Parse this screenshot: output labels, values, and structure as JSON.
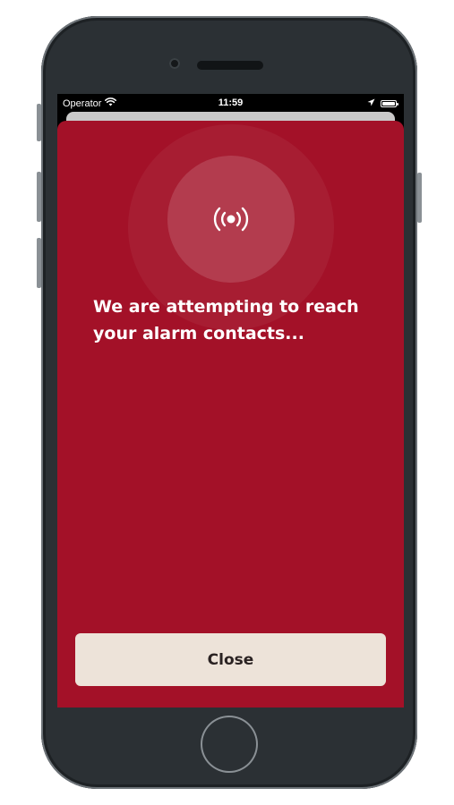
{
  "status_bar": {
    "carrier": "Operator",
    "time": "11:59",
    "wifi_icon": "wifi-icon",
    "location_icon": "location-arrow-icon",
    "battery_icon": "battery-icon"
  },
  "alarm": {
    "icon": "broadcast-signal-icon",
    "message": "We are attempting to reach your alarm contacts...",
    "close_label": "Close"
  },
  "colors": {
    "background": "#a31128",
    "button_background": "#ede3d9",
    "button_text": "#2a2222",
    "text": "#ffffff"
  }
}
